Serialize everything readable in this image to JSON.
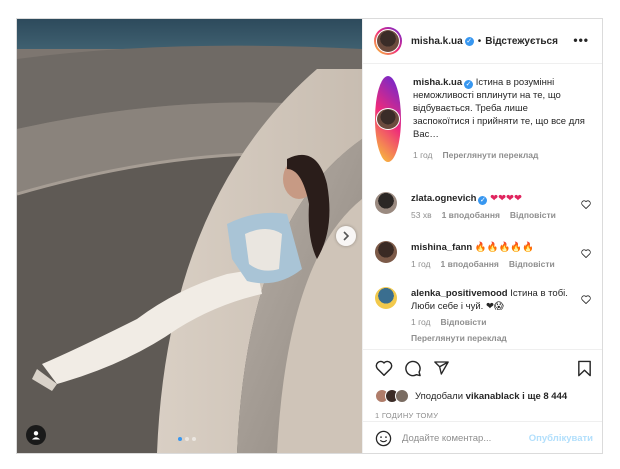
{
  "post": {
    "author": "misha.k.ua",
    "follow_status": "Відстежується",
    "more_label": "•••",
    "caption": "Істина в розумінні неможливості вплинути на те, що відбувається. Треба лише заспокоїтися і прийняти те, що все для Вас…",
    "caption_time": "1 год",
    "caption_translate": "Переглянути переклад",
    "carousel": {
      "slides": 3,
      "active": 1
    }
  },
  "comments": [
    {
      "user": "zlata.ognevich",
      "verified": true,
      "text": "❤❤❤❤",
      "time": "53 хв",
      "likes": "1 вподобання",
      "reply": "Відповісти"
    },
    {
      "user": "mishina_fann",
      "verified": false,
      "text": "🔥🔥🔥🔥🔥",
      "time": "1 год",
      "likes": "1 вподобання",
      "reply": "Відповісти"
    },
    {
      "user": "alenka_positivemood",
      "verified": false,
      "text": "Істина в тобі. Люби себе і чуй. ❤😱",
      "time": "1 год",
      "reply": "Відповісти",
      "translate": "Переглянути переклад"
    }
  ],
  "likes": {
    "prefix": "Уподобали",
    "user": "vikanablack",
    "rest": "і ще 8 444"
  },
  "timestamp": "1 ГОДИНУ ТОМУ",
  "add_comment": {
    "placeholder": "Додайте коментар...",
    "publish": "Опублікувати"
  },
  "icons": [
    "heart-icon",
    "comment-icon",
    "share-icon",
    "save-icon",
    "emoji-icon",
    "user-tag-icon",
    "chevron-right-icon",
    "verified-icon"
  ]
}
